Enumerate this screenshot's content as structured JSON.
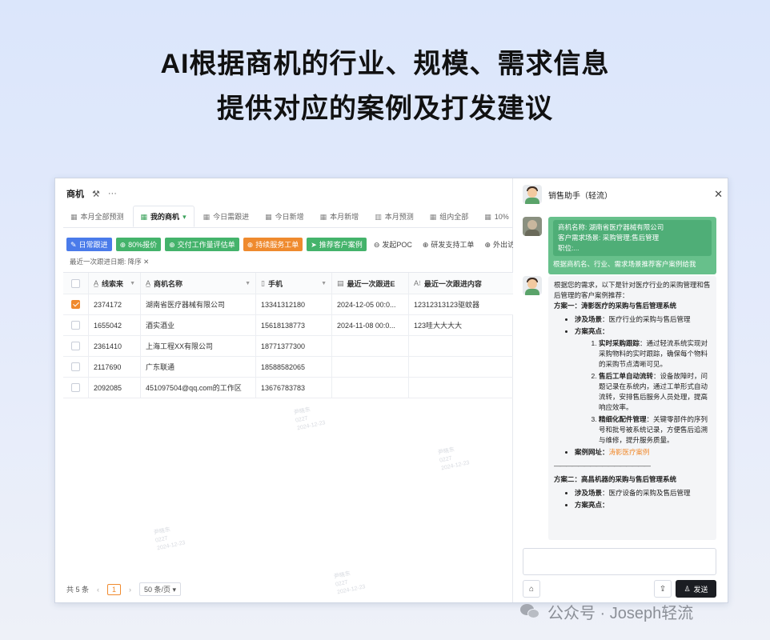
{
  "headline": {
    "line1": "AI根据商机的行业、规模、需求信息",
    "line2": "提供对应的案例及打发建议"
  },
  "app": {
    "title": "商机",
    "tabs": [
      {
        "label": "本月全部预测",
        "icon": "table-icon"
      },
      {
        "label": "我的商机",
        "icon": "table-icon",
        "active": true
      },
      {
        "label": "今日需跟进",
        "icon": "table-icon"
      },
      {
        "label": "今日新增",
        "icon": "table-icon"
      },
      {
        "label": "本月新增",
        "icon": "table-icon"
      },
      {
        "label": "本月预测",
        "icon": "kanban-icon"
      },
      {
        "label": "组内全部",
        "icon": "table-icon"
      },
      {
        "label": "10%",
        "icon": "table-icon"
      }
    ],
    "actions": [
      {
        "label": "日常跟进",
        "color": "#4a7bea",
        "icon": "✎"
      },
      {
        "label": "80%报价",
        "color": "#44b36b",
        "icon": "⊕"
      },
      {
        "label": "交付工作量评估单",
        "color": "#44b36b",
        "icon": "⊕"
      },
      {
        "label": "持续服务工单",
        "color": "#ef8a2e",
        "icon": "⊕"
      },
      {
        "label": "推荐客户案例",
        "color": "#44b36b",
        "icon": "➤"
      },
      {
        "label": "发起POC",
        "color": "",
        "icon": "⊖"
      },
      {
        "label": "研发支持工单",
        "color": "",
        "icon": "⊕"
      },
      {
        "label": "外出访",
        "color": "",
        "icon": "⊕"
      }
    ],
    "filter": "最近一次跟进日期: 降序 ✕",
    "columns": [
      "线索来",
      "商机名称",
      "手机",
      "最近一次跟进E",
      "最近一次跟进内容"
    ],
    "rows": [
      {
        "id": "2374172",
        "name": "湖南省医疗器械有限公司",
        "phone": "13341312180",
        "date": "2024-12-05 00:0...",
        "content": "12312313123驱蚊器",
        "checked": true
      },
      {
        "id": "1655042",
        "name": "酒实酒业",
        "phone": "15618138773",
        "date": "2024-11-08 00:0...",
        "content": "123哇大大大大",
        "checked": false
      },
      {
        "id": "2361410",
        "name": "上海工程XX有限公司",
        "phone": "18771377300",
        "date": "",
        "content": "",
        "checked": false
      },
      {
        "id": "2117690",
        "name": "广东联通",
        "phone": "18588582065",
        "date": "",
        "content": "",
        "checked": false
      },
      {
        "id": "2092085",
        "name": "451097504@qq.com的工作区",
        "phone": "13676783783",
        "date": "",
        "content": "",
        "checked": false
      }
    ],
    "pager": {
      "total": "共 5 条",
      "page": "1",
      "size": "50 条/页"
    }
  },
  "panel": {
    "title": "销售助手（轻流）",
    "user_quote": [
      "商机名称: 湖南省医疗器械有限公司",
      "客户需求场景: 采购管理;售后管理",
      "职位:..."
    ],
    "user_text": "根据商机名、行业、需求场景推荐客户案例给我",
    "bot": {
      "intro": "根据您的需求，以下是针对医疗行业的采购管理和售后管理的客户案例推荐：",
      "plan1_title": "方案一：涛影医疗的采购与售后管理系统",
      "plan1_scene_label": "涉及场景",
      "plan1_scene": "：医疗行业的采购与售后管理",
      "plan1_highlights_label": "方案亮点",
      "highlights": [
        {
          "title": "实时采购跟踪",
          "text": "：通过轻流系统实现对采购物料的实时跟踪，确保每个物料的采购节点清晰可见。"
        },
        {
          "title": "售后工单自动流转",
          "text": "：设备故障时，问题记录在系统内，通过工单形式自动流转，安排售后服务人员处理，提高响应效率。"
        },
        {
          "title": "精细化配件管理",
          "text": "：关键零部件的序列号和批号被系统记录，方便售后追溯与维修，提升服务质量。"
        }
      ],
      "case_label": "案例网址",
      "case_link": "涛影医疗案例",
      "separator": "————————————————",
      "plan2_title": "方案二：高昌机器的采购与售后管理系统",
      "plan2_scene_label": "涉及场景",
      "plan2_scene": "：医疗设备的采购及售后管理",
      "plan2_highlights_label": "方案亮点"
    },
    "send_label": "发送"
  },
  "watermark": [
    "尹晓东",
    "0227",
    "2024-12-23"
  ],
  "brand": "公众号 · Joseph轻流"
}
